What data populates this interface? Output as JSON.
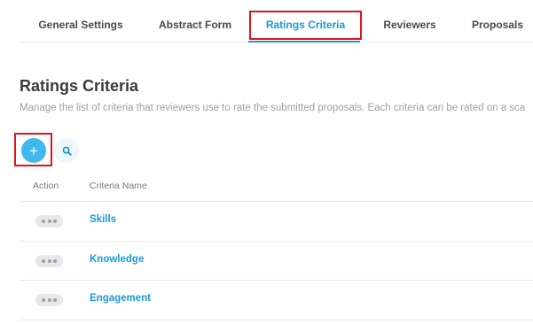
{
  "tabs": [
    {
      "label": "General Settings"
    },
    {
      "label": "Abstract Form"
    },
    {
      "label": "Ratings Criteria",
      "active": true
    },
    {
      "label": "Reviewers"
    },
    {
      "label": "Proposals"
    }
  ],
  "page": {
    "title": "Ratings Criteria",
    "description": "Manage the list of criteria that reviewers use to rate the submitted proposals. Each criteria can be rated on a sca"
  },
  "toolbar": {
    "add_label": "+",
    "add_icon": "plus-icon",
    "search_icon": "search-icon"
  },
  "table": {
    "headers": {
      "action": "Action",
      "name": "Criteria Name"
    },
    "rows": [
      {
        "name": "Skills"
      },
      {
        "name": "Knowledge"
      },
      {
        "name": "Engagement"
      }
    ]
  },
  "colors": {
    "accent": "#1a9ad6",
    "add_button": "#3fb8ee",
    "highlight": "#e0141e"
  }
}
